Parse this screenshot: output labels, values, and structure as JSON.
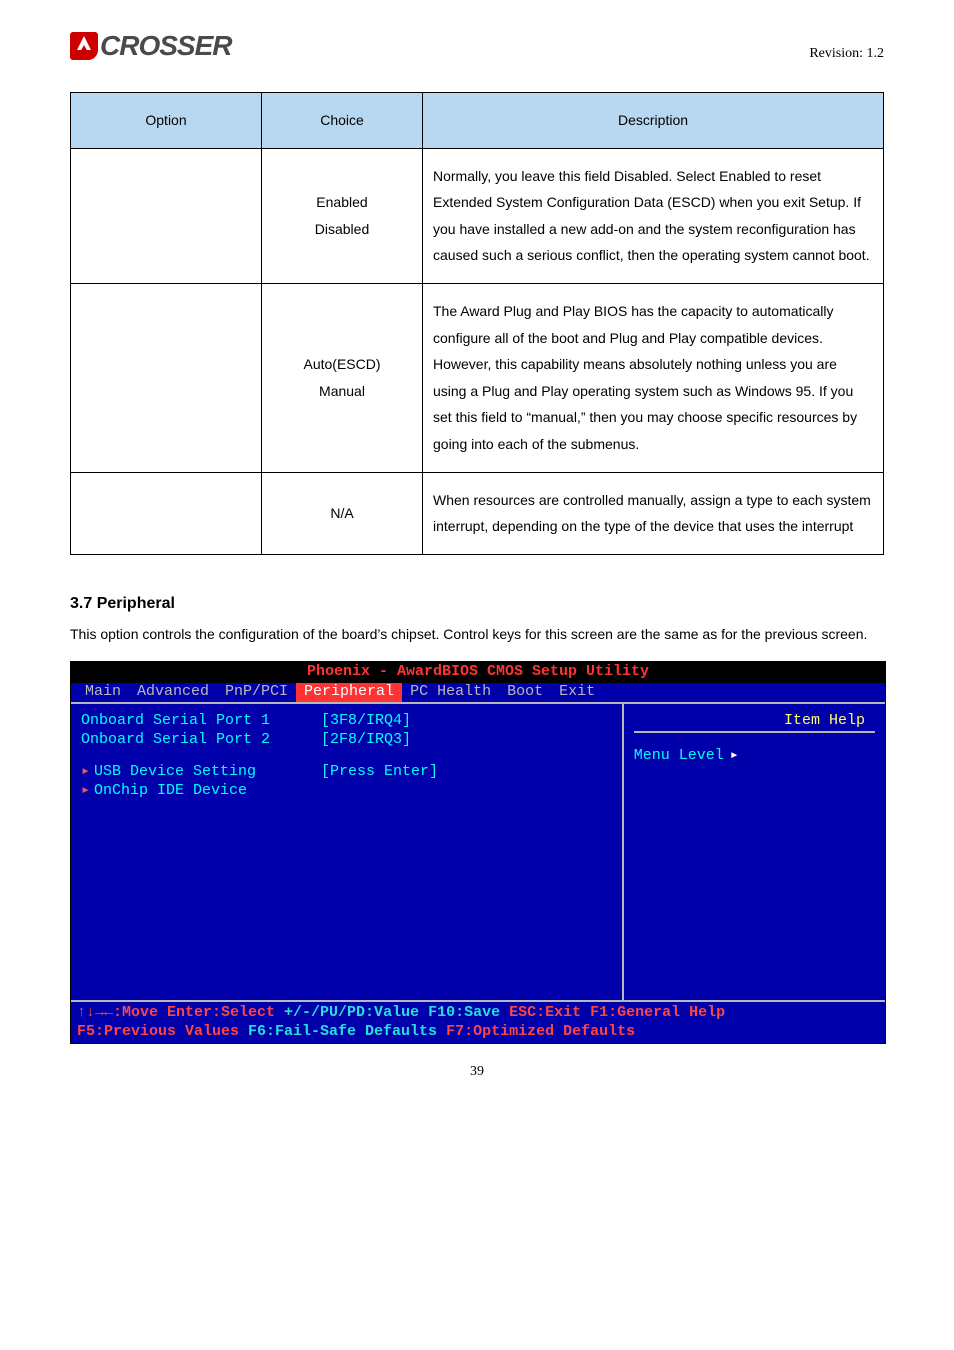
{
  "header": {
    "logo_text": "CROSSER",
    "revision": "Revision: 1.2"
  },
  "table": {
    "headers": {
      "option": "Option",
      "choice": "Choice",
      "description": "Description"
    },
    "rows": [
      {
        "option": "",
        "choice": "Enabled\nDisabled",
        "description": "Normally, you leave this field Disabled. Select Enabled to reset Extended System Configuration Data (ESCD) when you exit Setup. If you have installed a new add-on and the system reconfiguration has caused such a serious conflict, then the operating system cannot boot."
      },
      {
        "option": "",
        "choice": "Auto(ESCD)\nManual",
        "description": "The Award Plug and Play BIOS has the capacity to automatically configure all of the boot and Plug and Play compatible devices. However, this capability means absolutely nothing unless you are using a Plug and Play operating system such as Windows 95. If you set this field to “manual,” then you may choose specific resources by going into each of the submenus."
      },
      {
        "option": "",
        "choice": "N/A",
        "description": "When resources are controlled manually, assign a type to each system interrupt, depending on the type of the device that uses the interrupt"
      }
    ]
  },
  "section": {
    "heading": "3.7 Peripheral",
    "intro": "This option controls the configuration of the board’s chipset. Control keys for this screen are the same as for the previous screen."
  },
  "bios": {
    "title": "Phoenix - AwardBIOS CMOS Setup Utility",
    "menu": [
      "Main",
      "Advanced",
      "PnP/PCI",
      "Peripheral",
      "PC Health",
      "Boot",
      "Exit"
    ],
    "active_menu_index": 3,
    "items": [
      {
        "label": "Onboard Serial Port 1",
        "value": "3F8/IRQ4",
        "selected": true,
        "prefix": ""
      },
      {
        "label": "Onboard Serial Port 2",
        "value": "2F8/IRQ3",
        "selected": false,
        "prefix": ""
      },
      {
        "label": "USB Device Setting",
        "value": "Press Enter",
        "selected": false,
        "prefix": "▸"
      },
      {
        "label": "OnChip IDE Device",
        "value": "",
        "selected": false,
        "prefix": "▸"
      }
    ],
    "help_title": "Item Help",
    "menu_level": "Menu Level",
    "footer_line1_left": "↑↓→←:Move  Enter:Select  ",
    "footer_line1_mid": "+/-/PU/PD:Value  F10:Save  ",
    "footer_line1_right": "ESC:Exit  F1:General Help",
    "footer_line2_left": "F5:Previous Values   ",
    "footer_line2_mid": "F6:Fail-Safe Defaults   ",
    "footer_line2_right": "F7:Optimized Defaults"
  },
  "page_number": "39"
}
